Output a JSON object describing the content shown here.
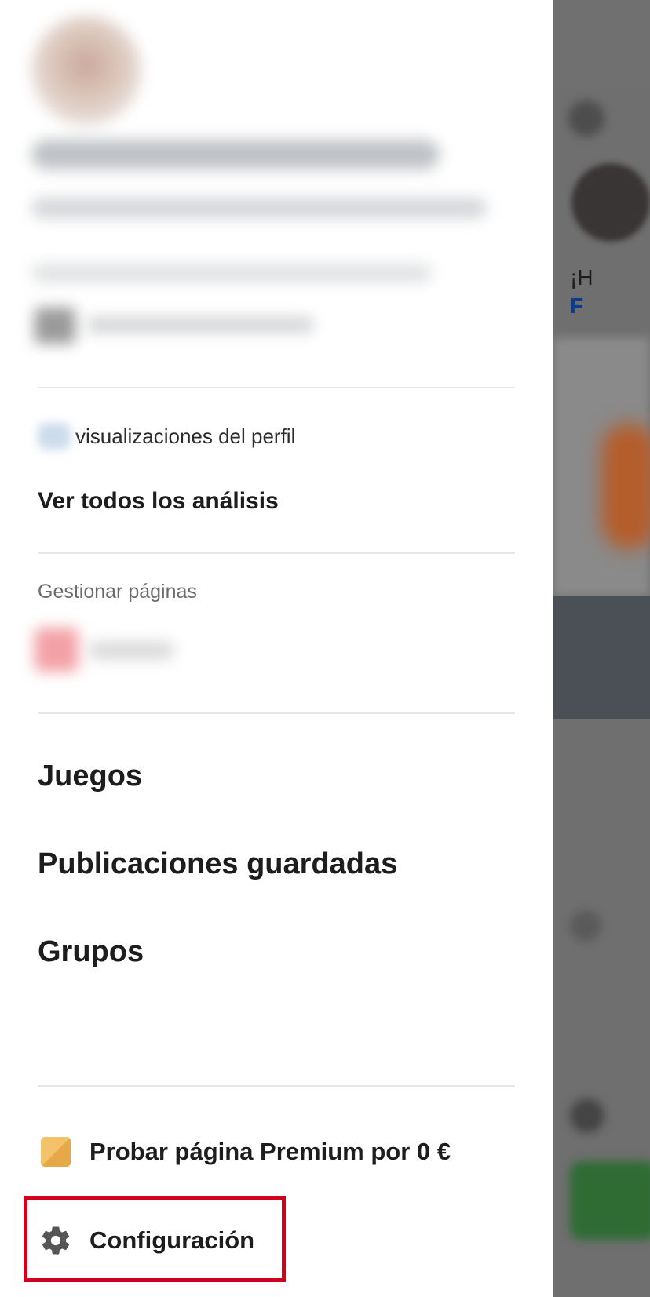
{
  "profile": {
    "views_label": "visualizaciones del perfil",
    "analytics_link": "Ver todos los análisis"
  },
  "pages": {
    "section_label": "Gestionar páginas"
  },
  "menu": {
    "items": [
      {
        "label": "Juegos"
      },
      {
        "label": "Publicaciones guardadas"
      },
      {
        "label": "Grupos"
      }
    ]
  },
  "footer": {
    "premium_label": "Probar página Premium por 0 €",
    "premium_icon": "premium-badge-icon",
    "settings_label": "Configuración",
    "settings_icon": "gear-icon"
  },
  "background_feed": {
    "text_line1": "¡H",
    "text_line2": "F"
  },
  "colors": {
    "highlight": "#d0021b",
    "premium_gold": "#e7a848"
  }
}
